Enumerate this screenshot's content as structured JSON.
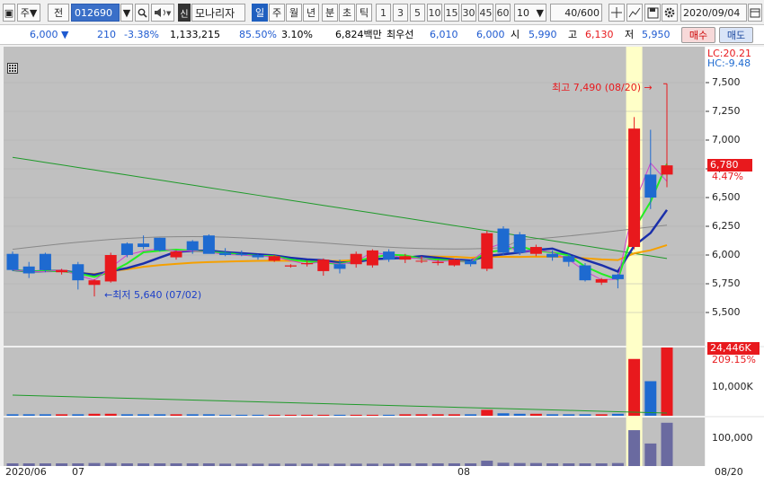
{
  "toolbar": {
    "market": "주",
    "code_label": "전",
    "code": "012690",
    "name_badge": "신",
    "name": "모나리자",
    "periods": [
      "일",
      "주",
      "월",
      "년",
      "분",
      "초",
      "틱"
    ],
    "minutes": [
      "1",
      "3",
      "5",
      "10",
      "15",
      "30",
      "45",
      "60"
    ],
    "count_select": "10",
    "count": "40",
    "count_max": "/600",
    "date": "2020/09/04"
  },
  "quote": {
    "price": "6,000",
    "change": "210",
    "pct": "-3.38%",
    "volume": "1,133,215",
    "vol_ratio": "85.50%",
    "turnover": "3.10%",
    "amount": "6,824백만",
    "best_label": "최우선",
    "ask": "6,010",
    "bid": "6,000",
    "open_label": "시",
    "open": "5,990",
    "high_label": "고",
    "high": "6,130",
    "low_label": "저",
    "low": "5,950",
    "buy": "매수",
    "sell": "매도"
  },
  "price_axis": {
    "lc": "LC:20.21",
    "hc": "HC:-9.48",
    "ticks": [
      "7,500",
      "7,250",
      "7,000",
      "6,750",
      "6,500",
      "6,250",
      "6,000",
      "5,750",
      "5,500"
    ],
    "tick_values": [
      7500,
      7250,
      7000,
      6750,
      6500,
      6250,
      6000,
      5750,
      5500
    ],
    "last_price": "6,780",
    "last_pct": "4.47%"
  },
  "volume_axis": {
    "last_vol": "24,446K",
    "vol_pct": "209.15%",
    "tick": "10,000K",
    "tick2": "100,000"
  },
  "annotations": {
    "high": "최고 7,490 (08/20)",
    "low": "최저 5,640 (07/02)"
  },
  "x_labels": [
    "2020/06",
    "07",
    "08",
    "08/20"
  ],
  "colors": {
    "up": "#e8191d",
    "down": "#1e6ad0",
    "bg": "#c0c0c0",
    "highlight": "#ffffc8"
  },
  "candles": [
    {
      "o": 6010,
      "h": 6030,
      "l": 5860,
      "c": 5870
    },
    {
      "o": 5900,
      "h": 5940,
      "l": 5800,
      "c": 5840
    },
    {
      "o": 6010,
      "h": 6020,
      "l": 5850,
      "c": 5870
    },
    {
      "o": 5850,
      "h": 5880,
      "l": 5830,
      "c": 5870
    },
    {
      "o": 5920,
      "h": 5940,
      "l": 5700,
      "c": 5780
    },
    {
      "o": 5740,
      "h": 5790,
      "l": 5640,
      "c": 5780
    },
    {
      "o": 5770,
      "h": 6020,
      "l": 5760,
      "c": 6000
    },
    {
      "o": 6100,
      "h": 6110,
      "l": 5980,
      "c": 6000
    },
    {
      "o": 6100,
      "h": 6170,
      "l": 6050,
      "c": 6070
    },
    {
      "o": 6150,
      "h": 6150,
      "l": 6030,
      "c": 6040
    },
    {
      "o": 5980,
      "h": 6040,
      "l": 5960,
      "c": 6030
    },
    {
      "o": 6120,
      "h": 6130,
      "l": 6010,
      "c": 6040
    },
    {
      "o": 6170,
      "h": 6180,
      "l": 6020,
      "c": 6010
    },
    {
      "o": 6020,
      "h": 6060,
      "l": 5990,
      "c": 6000
    },
    {
      "o": 6010,
      "h": 6040,
      "l": 5990,
      "c": 6000
    },
    {
      "o": 6000,
      "h": 6010,
      "l": 5960,
      "c": 5980
    },
    {
      "o": 5950,
      "h": 6000,
      "l": 5940,
      "c": 5990
    },
    {
      "o": 5900,
      "h": 5920,
      "l": 5890,
      "c": 5910
    },
    {
      "o": 5920,
      "h": 5950,
      "l": 5900,
      "c": 5930
    },
    {
      "o": 5860,
      "h": 5970,
      "l": 5820,
      "c": 5960
    },
    {
      "o": 5920,
      "h": 5960,
      "l": 5840,
      "c": 5880
    },
    {
      "o": 5920,
      "h": 6030,
      "l": 5890,
      "c": 6010
    },
    {
      "o": 5910,
      "h": 6050,
      "l": 5890,
      "c": 6040
    },
    {
      "o": 6030,
      "h": 6050,
      "l": 5940,
      "c": 5960
    },
    {
      "o": 5960,
      "h": 6010,
      "l": 5930,
      "c": 5990
    },
    {
      "o": 5950,
      "h": 5990,
      "l": 5930,
      "c": 5950
    },
    {
      "o": 5930,
      "h": 5960,
      "l": 5910,
      "c": 5940
    },
    {
      "o": 5910,
      "h": 5970,
      "l": 5900,
      "c": 5960
    },
    {
      "o": 5950,
      "h": 5960,
      "l": 5900,
      "c": 5920
    },
    {
      "o": 5880,
      "h": 6210,
      "l": 5860,
      "c": 6190
    },
    {
      "o": 6230,
      "h": 6250,
      "l": 6000,
      "c": 6020
    },
    {
      "o": 6180,
      "h": 6200,
      "l": 6000,
      "c": 6020
    },
    {
      "o": 6010,
      "h": 6090,
      "l": 5990,
      "c": 6070
    },
    {
      "o": 6010,
      "h": 6040,
      "l": 5950,
      "c": 5980
    },
    {
      "o": 5990,
      "h": 6010,
      "l": 5900,
      "c": 5940
    },
    {
      "o": 5910,
      "h": 5930,
      "l": 5770,
      "c": 5780
    },
    {
      "o": 5760,
      "h": 5800,
      "l": 5740,
      "c": 5790
    },
    {
      "o": 5830,
      "h": 5840,
      "l": 5710,
      "c": 5790
    },
    {
      "o": 6070,
      "h": 7200,
      "l": 6050,
      "c": 7100
    },
    {
      "o": 6700,
      "h": 7090,
      "l": 6400,
      "c": 6500
    },
    {
      "o": 6700,
      "h": 7490,
      "l": 6590,
      "c": 6780
    }
  ],
  "volumes": [
    3,
    3,
    3,
    3,
    3,
    4,
    4,
    3,
    3,
    3,
    3,
    3,
    3,
    2,
    2,
    2,
    2,
    2,
    2,
    2,
    2,
    2,
    2,
    2,
    3,
    3,
    3,
    3,
    3,
    12,
    5,
    4,
    4,
    3,
    3,
    3,
    3,
    4,
    115,
    70,
    140
  ]
}
